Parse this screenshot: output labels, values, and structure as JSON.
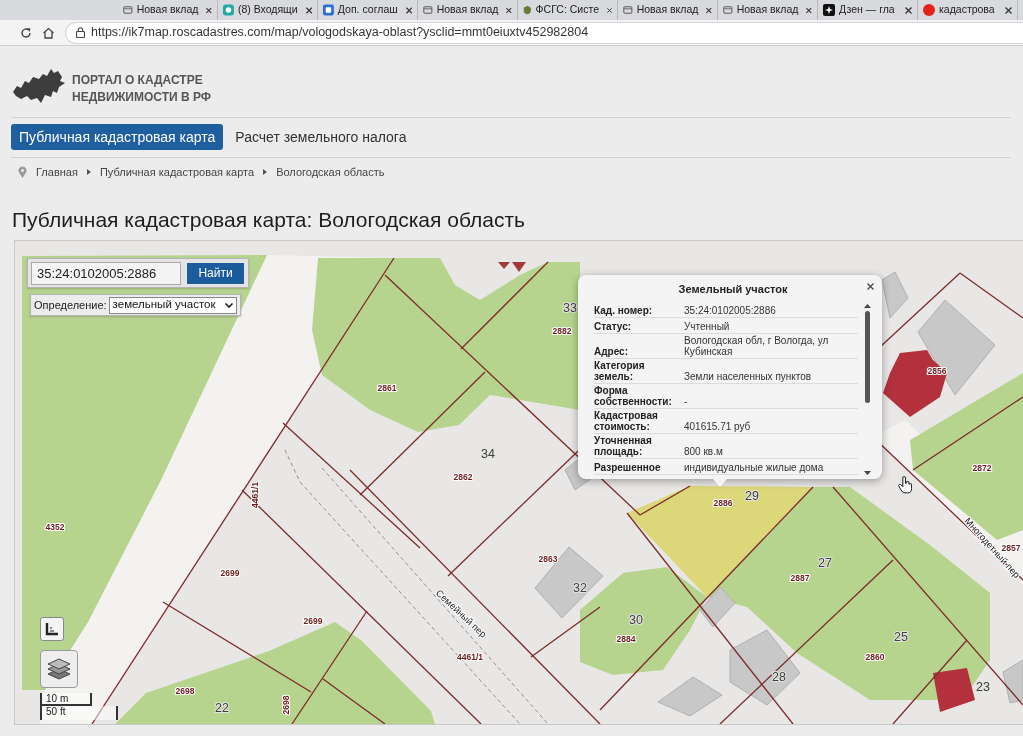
{
  "browser": {
    "tabs": [
      {
        "title": "Новая вклад"
      },
      {
        "title": "(8) Входящи"
      },
      {
        "title": "Доп. соглаш"
      },
      {
        "title": "Новая вклад"
      },
      {
        "title": "ФСГС: Систе"
      },
      {
        "title": "Новая вклад"
      },
      {
        "title": "Новая вклад"
      },
      {
        "title": "Дзен — гла"
      },
      {
        "title": "кадастрова"
      }
    ],
    "url": "https://ik7map.roscadastres.com/map/vologodskaya-oblast?ysclid=mmt0eiuxtv452982804"
  },
  "site": {
    "logo_lines": [
      "ПОРТАЛ О КАДАСТРЕ",
      "НЕДВИЖИМОСТИ В РФ"
    ]
  },
  "nav_tabs": [
    {
      "label": "Публичная кадастровая карта",
      "selected": true
    },
    {
      "label": "Расчет земельного налога",
      "selected": false
    }
  ],
  "breadcrumb": [
    "Главная",
    "Публичная кадастровая карта",
    "Вологодская область"
  ],
  "page_title": "Публичная кадастровая карта: Вологодская область",
  "map": {
    "search": {
      "value": "35:24:0102005:2886",
      "button": "Найти"
    },
    "definition": {
      "label": "Определение:",
      "value": "земельный участок"
    },
    "labels": [
      {
        "text": "33",
        "kind": "house"
      },
      {
        "text": "2882",
        "kind": "parcel"
      },
      {
        "text": "2861",
        "kind": "parcel"
      },
      {
        "text": "34",
        "kind": "house"
      },
      {
        "text": "2862",
        "kind": "parcel"
      },
      {
        "text": "4461/1",
        "kind": "parcel"
      },
      {
        "text": "4352",
        "kind": "parcel"
      },
      {
        "text": "2699",
        "kind": "parcel"
      },
      {
        "text": "2699",
        "kind": "parcel"
      },
      {
        "text": "2698",
        "kind": "parcel"
      },
      {
        "text": "22",
        "kind": "house"
      },
      {
        "text": "2698",
        "kind": "parcel"
      },
      {
        "text": "2863",
        "kind": "parcel"
      },
      {
        "text": "32",
        "kind": "house"
      },
      {
        "text": "Семейный пер",
        "kind": "street"
      },
      {
        "text": "4461/1",
        "kind": "parcel"
      },
      {
        "text": "2886",
        "kind": "parcel"
      },
      {
        "text": "29",
        "kind": "house"
      },
      {
        "text": "27",
        "kind": "house"
      },
      {
        "text": "2887",
        "kind": "parcel"
      },
      {
        "text": "30",
        "kind": "house"
      },
      {
        "text": "2884",
        "kind": "parcel"
      },
      {
        "text": "25",
        "kind": "house"
      },
      {
        "text": "2860",
        "kind": "parcel"
      },
      {
        "text": "28",
        "kind": "house"
      },
      {
        "text": "2856",
        "kind": "parcel"
      },
      {
        "text": "2872",
        "kind": "parcel"
      },
      {
        "text": "2857",
        "kind": "parcel"
      },
      {
        "text": "Многодетный пер",
        "kind": "street"
      },
      {
        "text": "23",
        "kind": "house"
      }
    ],
    "scale": [
      "10 m",
      "50 ft"
    ],
    "popup": {
      "title": "Земельный участок",
      "rows": [
        {
          "label": "Кад. номер:",
          "value": "35:24:0102005:2886"
        },
        {
          "label": "Статус:",
          "value": "Учтенный"
        },
        {
          "label": "Адрес:",
          "value": "Вологодская обл, г Вологда, ул Кубинская"
        },
        {
          "label": "Категория земель:",
          "value": "Земли населенных пунктов"
        },
        {
          "label": "Форма собственности:",
          "value": "-"
        },
        {
          "label": "Кадастровая стоимость:",
          "value": "401615.71 руб"
        },
        {
          "label": "Уточненная площадь:",
          "value": "800 кв.м"
        },
        {
          "label": "Разрешенное",
          "value": "индивидуальные жилые дома"
        }
      ]
    }
  }
}
